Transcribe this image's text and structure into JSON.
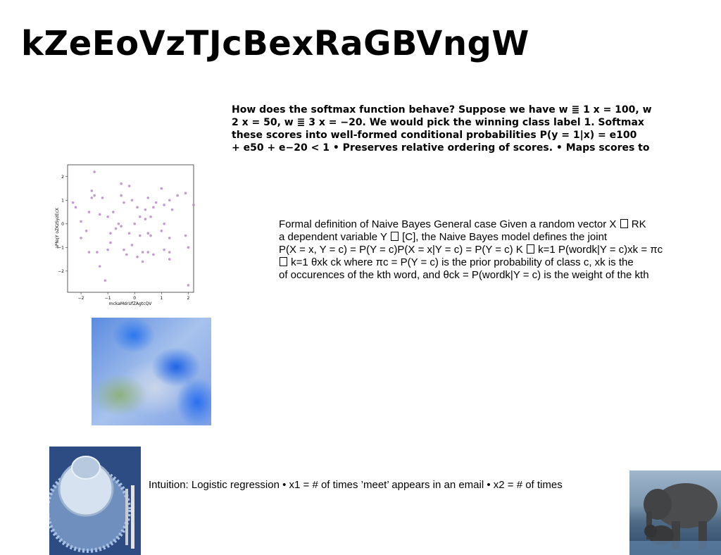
{
  "slide": {
    "title": "kZeEoVzTJcBexRaGBVngW",
    "softmax_paragraph": {
      "lines": [
        "How does the softmax function behave? Suppose we have w",
        "2 x = 50, w",
        "these scores into well-formed conditional probabilities P(y = 1|x) = e100",
        "+ e50 + e−20 < 1 • Preserves relative ordering of scores. • Maps scores to"
      ],
      "line1_tail": "1 x = 100, w",
      "line2_tail": "3 x = −20. We would pick the winning class label 1. Softmax"
    },
    "naive_bayes_paragraph": {
      "l1a": "Formal definition of Naive Bayes General case Given a random vector X",
      "l1b": "RK",
      "l2a": "a dependent variable Y",
      "l2b": "[C], the Naive Bayes model defines the joint",
      "l3a": "P(X = x, Y = c) = P(Y = c)P(X = x|Y = c) = P(Y = c) K",
      "l3b": "k=1 P(wordk|Y = c)xk = πc",
      "l4b": "k=1 θxk ck where πc = P(Y = c) is the prior probability of class c, xk is the",
      "l5": "of occurences of the kth word, and θck = P(wordk|Y = c) is the weight of the kth"
    },
    "intuition_text": "Intuition: Logistic regression • x1 = # of times ’meet’ appears in an email • x2 = # of times"
  },
  "chart_data": {
    "type": "scatter",
    "xlabel": "mckaMdrUfZAgtcQV",
    "ylabel": "aPNqY oZKzSyzEcX",
    "xlim": [
      -2.5,
      2.2
    ],
    "ylim": [
      -2.9,
      2.5
    ],
    "xticks": [
      -2,
      -1,
      0,
      1,
      2
    ],
    "yticks": [
      -2,
      -1,
      0,
      1,
      2
    ],
    "tick_labels_x": [
      "−2",
      "−1",
      "0",
      "1",
      "2"
    ],
    "tick_labels_y": [
      "−2",
      "−1",
      "0",
      "1",
      "2"
    ],
    "point_color": "#b88ac8",
    "points": [
      [
        -1.5,
        2.2
      ],
      [
        -2.3,
        0.9
      ],
      [
        -2.2,
        0.7
      ],
      [
        -1.6,
        1.1
      ],
      [
        -1.5,
        1.2
      ],
      [
        -1.6,
        1.4
      ],
      [
        -0.5,
        1.7
      ],
      [
        -0.2,
        1.6
      ],
      [
        -0.5,
        1.2
      ],
      [
        0.5,
        1.1
      ],
      [
        1.0,
        1.5
      ],
      [
        1.6,
        1.2
      ],
      [
        1.9,
        1.3
      ],
      [
        2.2,
        0.8
      ],
      [
        -1.3,
        0.4
      ],
      [
        -1.0,
        0.3
      ],
      [
        -0.8,
        0.5
      ],
      [
        -0.4,
        0.9
      ],
      [
        0.0,
        0.0
      ],
      [
        0.2,
        0.3
      ],
      [
        0.4,
        0.2
      ],
      [
        0.6,
        0.3
      ],
      [
        0.8,
        0.9
      ],
      [
        1.1,
        0.8
      ],
      [
        1.3,
        1.0
      ],
      [
        0.7,
        0.7
      ],
      [
        -2.0,
        0.1
      ],
      [
        -1.8,
        -0.3
      ],
      [
        -1.7,
        0.5
      ],
      [
        -0.9,
        -0.4
      ],
      [
        -0.7,
        -0.2
      ],
      [
        -0.5,
        -0.1
      ],
      [
        -0.2,
        -0.4
      ],
      [
        0.2,
        -0.5
      ],
      [
        0.5,
        -0.4
      ],
      [
        0.6,
        -0.5
      ],
      [
        1.0,
        -0.3
      ],
      [
        1.1,
        0.0
      ],
      [
        1.3,
        -0.6
      ],
      [
        1.9,
        -0.5
      ],
      [
        -2.0,
        -0.6
      ],
      [
        -1.7,
        -1.2
      ],
      [
        -1.4,
        -1.2
      ],
      [
        -1.0,
        -1.1
      ],
      [
        -0.9,
        -0.8
      ],
      [
        -0.4,
        -1.1
      ],
      [
        -0.1,
        -0.9
      ],
      [
        0.3,
        -1.2
      ],
      [
        0.5,
        -1.2
      ],
      [
        0.7,
        -1.3
      ],
      [
        1.1,
        -1.1
      ],
      [
        1.3,
        -1.2
      ],
      [
        2.0,
        -1.0
      ],
      [
        -1.3,
        -1.8
      ],
      [
        -1.1,
        -2.4
      ],
      [
        -0.3,
        -1.3
      ],
      [
        0.1,
        -1.4
      ],
      [
        0.3,
        -1.6
      ],
      [
        1.3,
        -1.5
      ],
      [
        2.0,
        -2.6
      ],
      [
        0.1,
        0.7
      ],
      [
        -0.1,
        1.0
      ],
      [
        0.4,
        0.6
      ],
      [
        1.4,
        0.6
      ],
      [
        -1.2,
        1.1
      ],
      [
        -0.6,
        0.0
      ]
    ]
  },
  "images": {
    "flowers": "blue-flowers-photo",
    "plate": "plate-and-glass-photo",
    "elephant": "elephants-photo"
  }
}
